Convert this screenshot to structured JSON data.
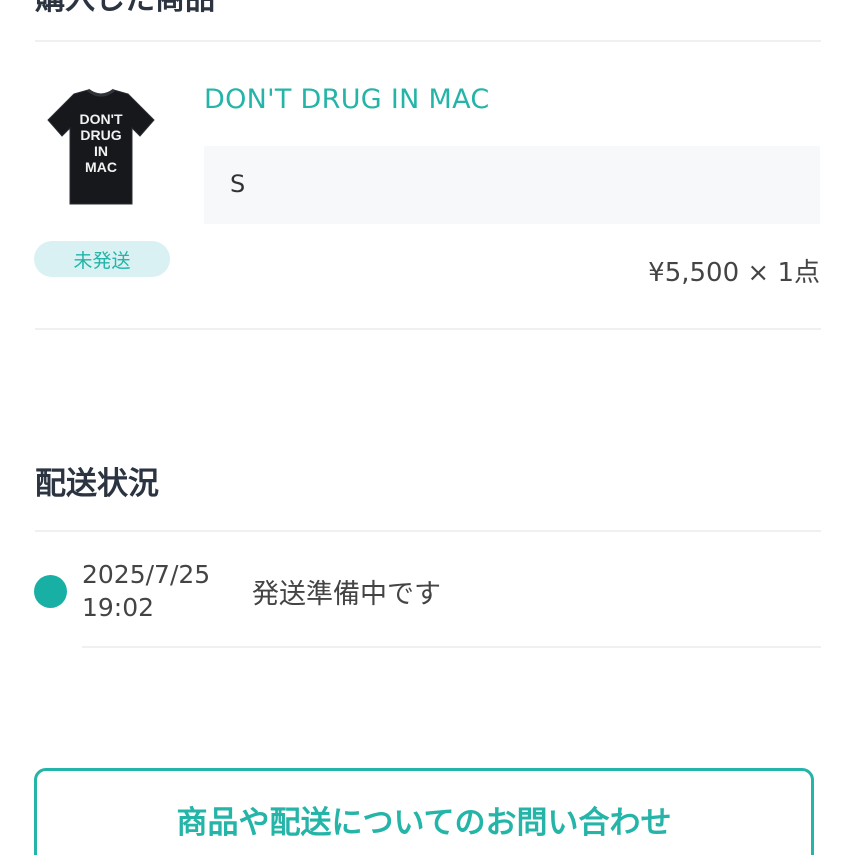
{
  "purchased_section": {
    "title": "購入した商品"
  },
  "product": {
    "name": "DON'T DRUG IN MAC",
    "variant": "S",
    "status_badge": "未発送",
    "price": "¥5,500 × 1点",
    "image_print_lines": [
      "DON'T",
      "DRUG",
      "IN",
      "MAC"
    ],
    "accent_color": "#24b4a8"
  },
  "shipping_section": {
    "title": "配送状況",
    "timeline": [
      {
        "date": "2025/7/25",
        "time": "19:02",
        "message": "発送準備中です"
      }
    ]
  },
  "contact_button": {
    "label": "商品や配送についてのお問い合わせ"
  }
}
